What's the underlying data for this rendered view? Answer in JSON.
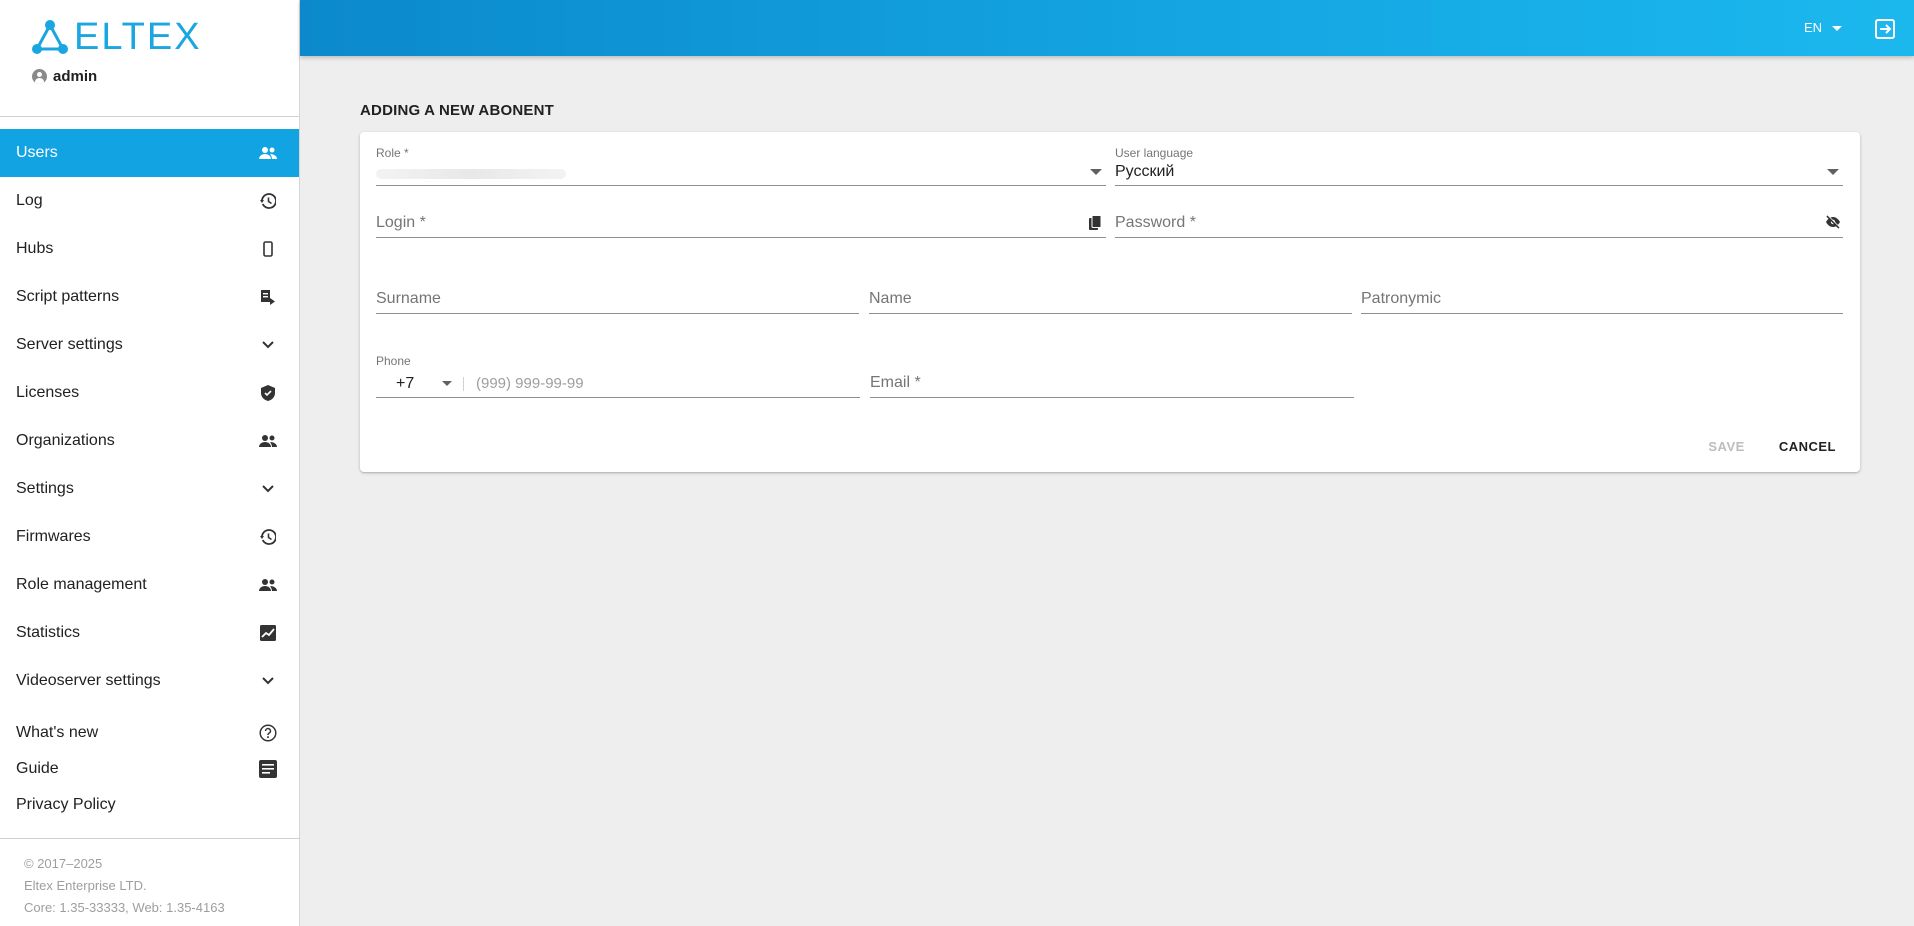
{
  "brand": {
    "name": "ELTEX",
    "color": "#1aa6e0"
  },
  "user": {
    "name": "admin"
  },
  "nav": [
    {
      "label": "Users",
      "icon": "group-icon",
      "active": true
    },
    {
      "label": "Log",
      "icon": "history-icon"
    },
    {
      "label": "Hubs",
      "icon": "phone-device-icon"
    },
    {
      "label": "Script patterns",
      "icon": "script-icon"
    },
    {
      "label": "Server settings",
      "icon": "chevron-down-icon"
    },
    {
      "label": "Licenses",
      "icon": "shield-icon"
    },
    {
      "label": "Organizations",
      "icon": "group-icon"
    },
    {
      "label": "Settings",
      "icon": "chevron-down-icon"
    },
    {
      "label": "Firmwares",
      "icon": "history-icon"
    },
    {
      "label": "Role management",
      "icon": "group-icon"
    },
    {
      "label": "Statistics",
      "icon": "chart-icon"
    },
    {
      "label": "Videoserver settings",
      "icon": "chevron-down-icon"
    }
  ],
  "links": [
    {
      "label": "What's new",
      "icon": "help-circle-icon"
    },
    {
      "label": "Guide",
      "icon": "document-icon"
    },
    {
      "label": "Privacy Policy"
    }
  ],
  "footer": {
    "copyright": "© 2017–2025",
    "company": "Eltex Enterprise LTD.",
    "version": "Core: 1.35-33333, Web: 1.35-4163"
  },
  "topbar": {
    "lang": "EN",
    "accent": "#12a3e3"
  },
  "page": {
    "title": "ADDING A NEW ABONENT"
  },
  "form": {
    "role_label": "Role *",
    "user_language_label": "User language",
    "user_language_value": "Русский",
    "login_placeholder": "Login *",
    "password_placeholder": "Password *",
    "surname_placeholder": "Surname",
    "name_placeholder": "Name",
    "patronymic_placeholder": "Patronymic",
    "phone_label": "Phone",
    "phone_code": "+7",
    "phone_placeholder": "(999) 999-99-99",
    "email_placeholder": "Email *"
  },
  "actions": {
    "save": "SAVE",
    "cancel": "CANCEL"
  }
}
